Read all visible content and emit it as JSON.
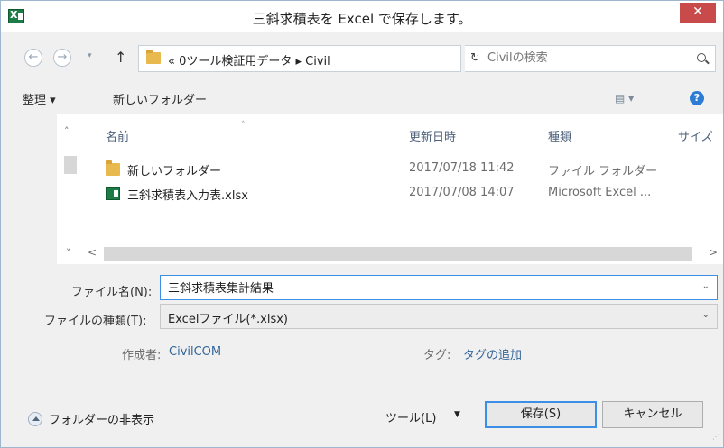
{
  "window": {
    "title": "三斜求積表を Excel で保存します。",
    "close_label": "✕"
  },
  "address": {
    "back_label": "←",
    "forward_label": "→",
    "history_label": "▾",
    "up_label": "↑",
    "path_label": "« 0ツール検証用データ ▸ Civil",
    "path_dropdown_label": "⌄",
    "refresh_label": "↻",
    "search_placeholder": "Civilの検索",
    "search_value": ""
  },
  "toolbar": {
    "organize_label": "整理 ▾",
    "new_folder_label": "新しいフォルダー",
    "view_label": "▤ ▾",
    "help_label": "?"
  },
  "file_list": {
    "columns": [
      "名前",
      "更新日時",
      "種類",
      "サイズ"
    ],
    "rows": [
      {
        "name": "新しいフォルダー",
        "date": "2017/07/18 11:42",
        "type": "ファイル フォルダー",
        "icon": "folder-icon"
      },
      {
        "name": "三斜求積表入力表.xlsx",
        "date": "2017/07/08 14:07",
        "type": "Microsoft Excel ...",
        "icon": "excel-file-icon"
      }
    ],
    "scroll_up_label": "˄",
    "scroll_down_label": "˅",
    "scroll_left_label": "<",
    "scroll_right_label": ">",
    "sort_caret": "˄"
  },
  "form": {
    "filename_label": "ファイル名(N):",
    "filename_value": "三斜求積表集計結果",
    "filetype_label": "ファイルの種類(T):",
    "filetype_value": "Excelファイル(*.xlsx)",
    "dropdown_glyph": "⌄",
    "author_label": "作成者:",
    "author_value": "CivilCOM",
    "tag_label": "タグ:",
    "tag_value": "タグの追加"
  },
  "footer": {
    "hide_folders_label": "フォルダーの非表示",
    "tools_label": "ツール(L)",
    "tools_dropdown": "▼",
    "save_label": "保存(S)",
    "cancel_label": "キャンセル",
    "grip_label": "⋰"
  }
}
